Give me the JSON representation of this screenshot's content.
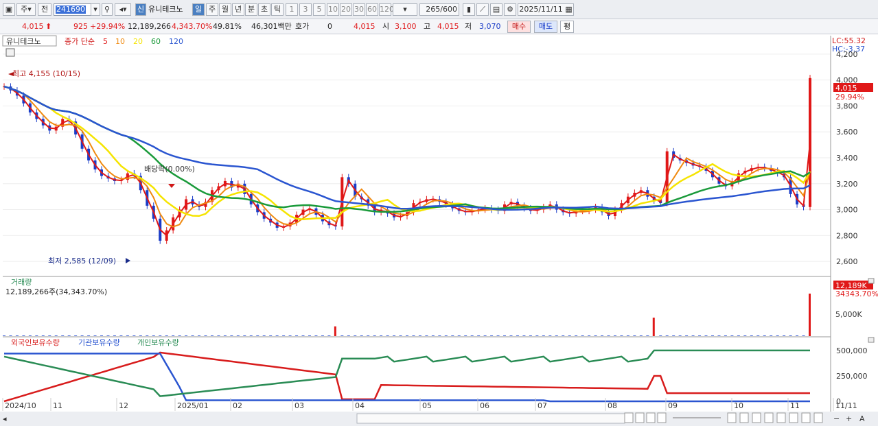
{
  "toolbar": {
    "period_main": "주",
    "prev": "전",
    "code": "241690",
    "name": "유니테크노",
    "new_badge": "신",
    "periods": [
      "일",
      "주",
      "월",
      "년",
      "분",
      "초",
      "틱"
    ],
    "active_period": "일",
    "nums": [
      "1",
      "3",
      "5",
      "10",
      "20",
      "30",
      "60",
      "120"
    ],
    "count": "265",
    "count_total": "/600",
    "date": "2025/11/11"
  },
  "quote": {
    "price": "4,015",
    "change": "925",
    "change_pct": "+29.94%",
    "volume": "12,189,266",
    "vol_pct": "4,343.70%",
    "turnover": "49.81%",
    "amount": "46,301백만",
    "bid_label": "호가",
    "bid": "0",
    "quote_price": "4,015",
    "open_label": "시",
    "open": "3,100",
    "high_label": "고",
    "high": "4,015",
    "low_label": "저",
    "low": "3,070",
    "buy_btn": "매수",
    "sell_btn": "매도",
    "eval_btn": "평"
  },
  "chart_data": {
    "type": "line",
    "title": "유니테크노",
    "legend_prefix": "종가 단순",
    "ma_periods": [
      "5",
      "10",
      "20",
      "60",
      "120"
    ],
    "ma_colors": [
      "#e01818",
      "#f08a10",
      "#f5e400",
      "#1a9a3a",
      "#2a55d0"
    ],
    "lc": "LC:55.32",
    "hc": "HC:-3.37",
    "price_ticks": [
      "4,200",
      "4,000",
      "3,800",
      "3,600",
      "3,400",
      "3,200",
      "3,000",
      "2,800",
      "2,600"
    ],
    "current_label": "4,015",
    "current_pct": "29.94%",
    "annotations": {
      "high": "최고 4,155 (10/15)",
      "low": "최저 2,585 (12/09)",
      "dividend": "배당락(0.00%)"
    },
    "close": [
      3950,
      3920,
      3880,
      3820,
      3750,
      3700,
      3650,
      3610,
      3640,
      3700,
      3680,
      3580,
      3470,
      3380,
      3310,
      3260,
      3240,
      3220,
      3230,
      3280,
      3260,
      3150,
      3030,
      2930,
      2760,
      2840,
      2940,
      3000,
      3080,
      3040,
      3020,
      3060,
      3150,
      3180,
      3220,
      3170,
      3200,
      3120,
      3040,
      2980,
      2930,
      2900,
      2860,
      2870,
      2900,
      2960,
      3000,
      3010,
      2960,
      2910,
      2880,
      2870,
      3250,
      3200,
      3100,
      3080,
      3030,
      2980,
      3000,
      2970,
      2940,
      2950,
      2980,
      3050,
      3060,
      3080,
      3080,
      3060,
      3040,
      3010,
      2990,
      2980,
      2990,
      3000,
      3010,
      3000,
      2990,
      3040,
      3060,
      3030,
      3010,
      2990,
      3000,
      3020,
      3040,
      3000,
      2980,
      2970,
      2990,
      2990,
      3000,
      3020,
      2980,
      2950,
      3000,
      3050,
      3100,
      3130,
      3150,
      3100,
      3070,
      3050,
      3450,
      3400,
      3380,
      3360,
      3340,
      3330,
      3300,
      3250,
      3200,
      3180,
      3220,
      3280,
      3300,
      3320,
      3330,
      3320,
      3300,
      3280,
      3250,
      3120,
      3040,
      3020,
      4015
    ],
    "volume_label": "거래량",
    "volume_text": "12,189,266주(34,343.70%)",
    "volume_current": "12,189K",
    "volume_pct": "34343.70%",
    "volume_tick": "5,000K",
    "vol_spikes": [
      {
        "i": 51,
        "v": 2800
      },
      {
        "i": 100,
        "v": 5300
      },
      {
        "i": 124,
        "v": 12189
      }
    ],
    "holdings_legend": [
      "외국인보유수량",
      "기관보유수량",
      "개인보유수량"
    ],
    "holdings_colors": [
      "#d81c1c",
      "#2a55d0",
      "#2a8c55"
    ],
    "holdings_ticks": [
      "500,000",
      "250,000",
      "0"
    ],
    "x_labels": [
      "2024/10",
      "11",
      "12",
      "2025/01",
      "02",
      "03",
      "04",
      "05",
      "06",
      "07",
      "08",
      "09",
      "10",
      "11",
      "11/11"
    ]
  }
}
